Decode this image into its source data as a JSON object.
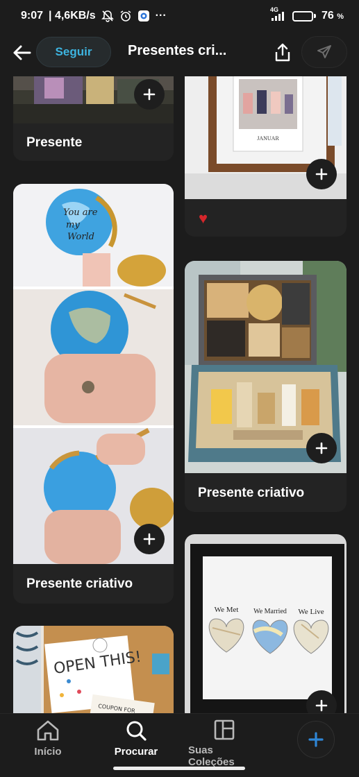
{
  "status_bar": {
    "time": "9:07",
    "speed": "| 4,6KB/s",
    "dots": "···",
    "network": "4G",
    "battery_text": "76",
    "battery_unit": "%",
    "battery_level": 0.76
  },
  "header": {
    "follow_label": "Seguir",
    "title": "Presentes cri..."
  },
  "feed": {
    "cards": [
      {
        "title": "Presente",
        "image": "gift-photo-top"
      },
      {
        "title": "",
        "image": "photo-frame-with-polaroids",
        "heart": "♥"
      },
      {
        "title": "Presente criativo",
        "image": "painted-globe-gift"
      },
      {
        "title": "Presente criativo",
        "image": "gift-box-with-photos"
      },
      {
        "title": "",
        "image": "open-this-gift-box"
      },
      {
        "title": "",
        "image": "heart-maps-frame",
        "frame_labels": [
          "We Met",
          "We Married",
          "We Live"
        ]
      }
    ],
    "box_lid_text": "OPEN THIS!",
    "coupon_text": "COUPON FOR",
    "frame_month": "JANUAR"
  },
  "bottom_nav": {
    "home_label": "Início",
    "search_label": "Procurar",
    "collections_label": "Suas Coleções"
  },
  "colors": {
    "background": "#1c1c1c",
    "card": "#232323",
    "accent_blue": "#3db4e0",
    "add_blue": "#2f86d6",
    "heart_red": "#d6262b"
  }
}
